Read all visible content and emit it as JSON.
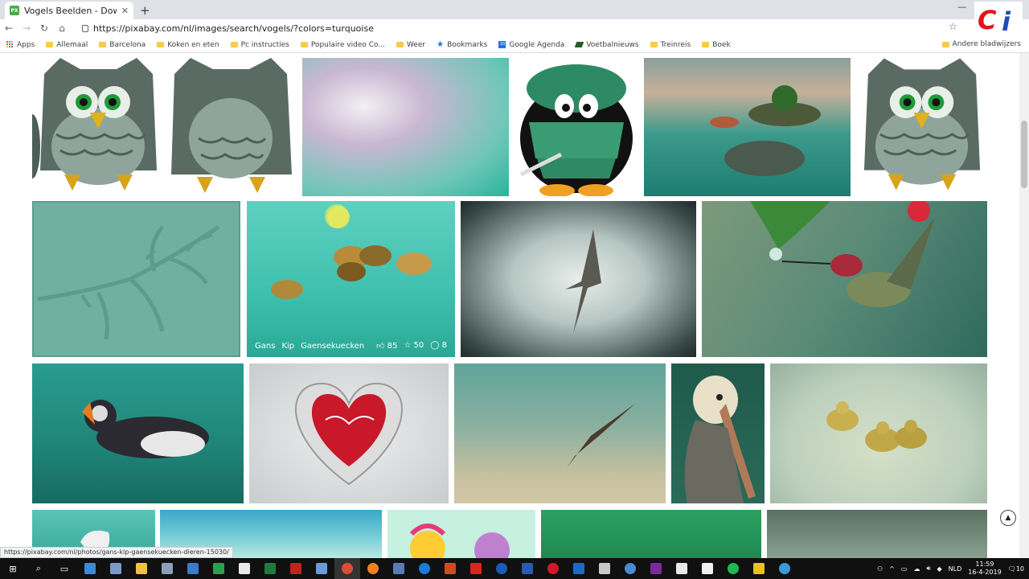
{
  "browser": {
    "tab_title": "Vogels Beelden - Download grati",
    "tab_icon": "pixabay-icon",
    "favicon_text": "PX",
    "url": "https://pixabay.com/nl/images/search/vogels/?colors=turquoise",
    "status_url": "https://pixabay.com/nl/photos/gans-kip-gaensekuecken-dieren-15030/"
  },
  "bookmarks": {
    "items": [
      {
        "label": "Apps"
      },
      {
        "label": "Allemaal"
      },
      {
        "label": "Barcelona"
      },
      {
        "label": "Koken en eten"
      },
      {
        "label": "Pc instructies"
      },
      {
        "label": "Populaire video Co..."
      },
      {
        "label": "Weer"
      },
      {
        "label": "Bookmarks"
      },
      {
        "label": "Google Agenda"
      },
      {
        "label": "Voetbalnieuws"
      },
      {
        "label": "Treinreis"
      },
      {
        "label": "Boek"
      }
    ],
    "other": "Andere bladwijzers"
  },
  "logo": {
    "c": "C",
    "i": "i"
  },
  "gallery": {
    "hover_tile": {
      "tags": [
        "Gans",
        "Kip",
        "Gaensekuecken"
      ],
      "likes": "85",
      "favorites": "50",
      "comments": "8"
    }
  },
  "taskbar": {
    "language": "NLD",
    "time": "11:59",
    "date": "16-4-2019",
    "notifications": "10"
  },
  "colors": {
    "accent": "#48a947",
    "turquoise": "#5fb8a8"
  }
}
